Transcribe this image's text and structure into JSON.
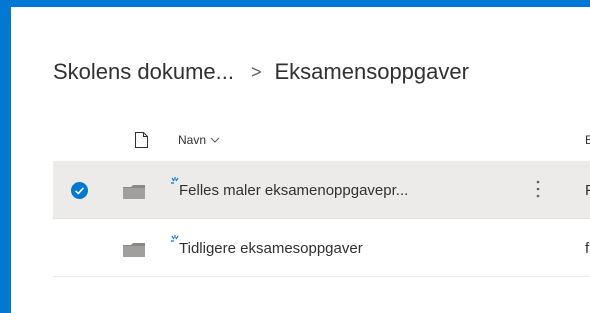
{
  "breadcrumb": {
    "parent": "Skolens dokume...",
    "separator": ">",
    "current": "Eksamensoppgaver"
  },
  "columns": {
    "name_label": "Navn",
    "modified_label": "E"
  },
  "rows": [
    {
      "name": "Felles maler eksamenoppgavepr...",
      "modified": "F",
      "selected": true
    },
    {
      "name": "Tidligere eksamesoppgaver",
      "modified": "f",
      "selected": false
    }
  ],
  "icons": {
    "file_type": "file-icon",
    "sort": "chevron-down-icon",
    "check": "checkmark-circle-icon",
    "folder": "folder-icon",
    "new": "new-badge-icon",
    "more": "more-vertical-icon"
  },
  "colors": {
    "accent": "#0078d4",
    "selected_row": "#edebe9",
    "folder": "#8a8886"
  }
}
